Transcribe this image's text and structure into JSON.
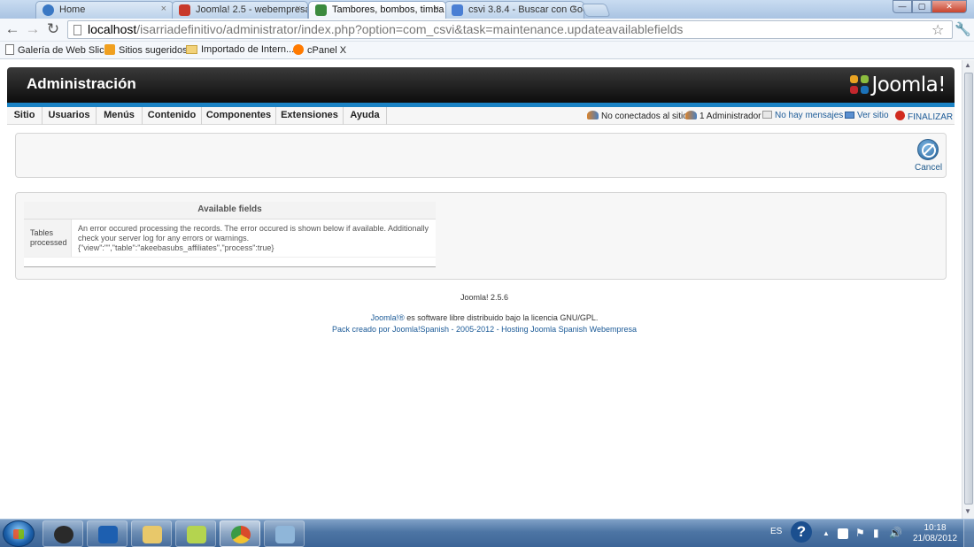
{
  "browser": {
    "tabs": [
      {
        "title": "Home",
        "favicon_color": "#3a78c4"
      },
      {
        "title": "Joomla! 2.5 - webempresa",
        "favicon_color": "#c83a2c"
      },
      {
        "title": "Tambores, bombos, timba",
        "favicon_color": "#3b8a3e"
      },
      {
        "title": "csvi 3.8.4 - Buscar con Goo",
        "favicon_color": "#4a7fd4"
      }
    ],
    "active_tab": 2,
    "close_glyph": "×",
    "window_buttons": {
      "minimize": "—",
      "maximize": "▢",
      "close": "✕"
    },
    "url_host": "localhost",
    "url_path": "/isarriadefinitivo/administrator/index.php?option=com_csvi&task=maintenance.updateavailablefields",
    "icons": [
      "back-arrow-icon",
      "forward-arrow-icon",
      "reload-icon",
      "page-icon",
      "star-icon",
      "wrench-icon"
    ],
    "nav_glyphs": {
      "back": "←",
      "forward": "→",
      "reload": "↻",
      "star": "☆",
      "wrench": "🔧"
    },
    "bookmarks": [
      {
        "label": "Galería de Web Slice",
        "icon_color": "#ffffff"
      },
      {
        "label": "Sitios sugeridos",
        "icon_color": "#f0a020"
      },
      {
        "label": "Importado de Intern...",
        "icon_color": "#f2d27a"
      },
      {
        "label": "cPanel X",
        "icon_color": "#ff7a00"
      }
    ]
  },
  "joomla": {
    "header_title": "Administración",
    "logo_text": "Joomla!",
    "logo_colors": [
      "#e9a322",
      "#8cbd3f",
      "#c3272d",
      "#1b72b9"
    ],
    "menu": [
      "Sitio",
      "Usuarios",
      "Menús",
      "Contenido",
      "Componentes",
      "Extensiones",
      "Ayuda"
    ],
    "status": {
      "visitors": "No conectados al sitio",
      "admins": "1 Administrador",
      "messages": "No hay mensajes",
      "view_site": "Ver sitio",
      "logout": "FINALIZAR"
    },
    "toolbar": {
      "cancel_label": "Cancel"
    },
    "available_fields": {
      "heading": "Available fields",
      "row_label": "Tables processed",
      "message": "An error occured processing the records. The error occured is shown below if available. Additionally check your server log for any errors or warnings.",
      "detail": "{\"view\":\"\",\"table\":\"akeebasubs_affiliates\",\"process\":true}"
    },
    "footer": {
      "version": "Joomla! 2.5.6",
      "license_link": "Joomla!®",
      "license_text": " es software libre distribuido bajo la licencia GNU/GPL.",
      "pack_text": "Pack creado por Joomla!Spanish - 2005-2012 - Hosting Joomla Spanish Webempresa"
    },
    "accent_color": "#1a82c4",
    "logout_color": "#d12b1f"
  },
  "taskbar": {
    "language": "ES",
    "time": "10:18",
    "date": "21/08/2012",
    "app_colors": [
      "#2a2a2a",
      "#1d5fb0",
      "#e8c86a",
      "#b4d44f",
      "#d94b2b",
      "#8fb6d9"
    ],
    "tray_glyphs": {
      "help": "?",
      "expand": "▲",
      "flag": "⚑",
      "signal": "▮",
      "volume": "🔊"
    }
  }
}
